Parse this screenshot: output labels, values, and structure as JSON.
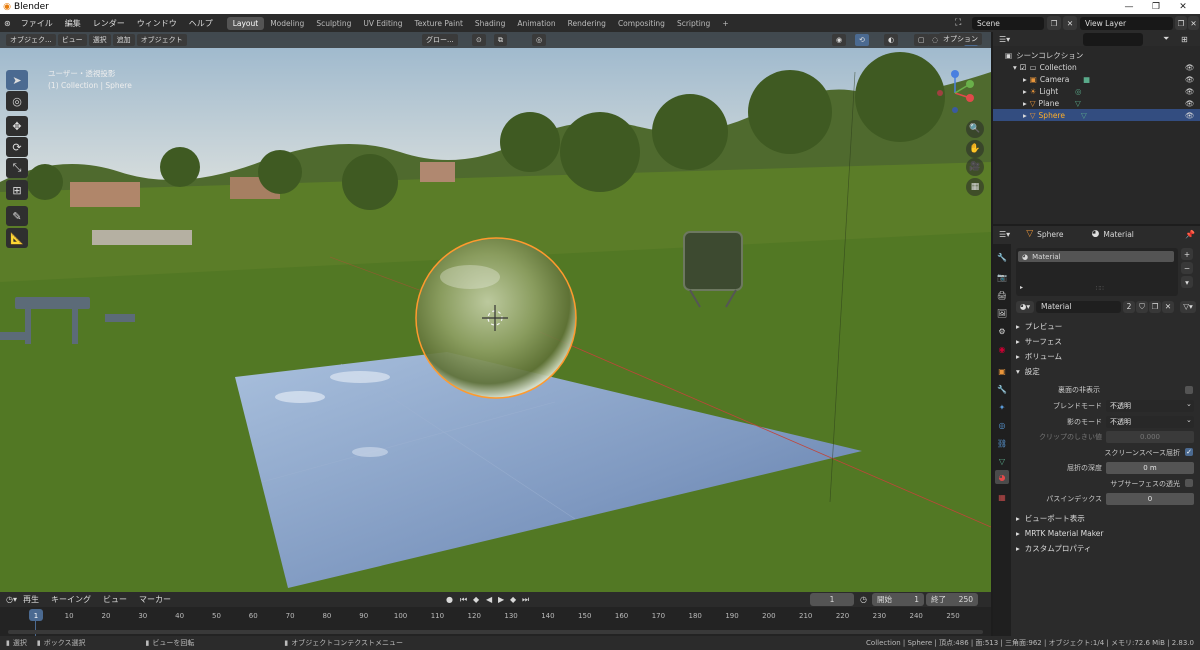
{
  "app": {
    "title": "Blender",
    "logo": "blender-logo-icon"
  },
  "menus": [
    "ファイル",
    "編集",
    "レンダー",
    "ウィンドウ",
    "ヘルプ"
  ],
  "workspaces": [
    "Layout",
    "Modeling",
    "Sculpting",
    "UV Editing",
    "Texture Paint",
    "Shading",
    "Animation",
    "Rendering",
    "Compositing",
    "Scripting",
    "+"
  ],
  "scene": {
    "label": "Scene"
  },
  "viewlayer": {
    "label": "View Layer"
  },
  "viewport_header": {
    "mode": "オブジェク...",
    "menus": [
      "ビュー",
      "選択",
      "追加",
      "オブジェクト"
    ],
    "transform": "グロー...",
    "options": "オプション"
  },
  "viewport_overlay": {
    "view_name": "ユーザー・透視投影",
    "object_info": "(1) Collection | Sphere"
  },
  "outliner": {
    "title": "シーンコレクション",
    "items": [
      {
        "name": "Collection"
      },
      {
        "name": "Camera"
      },
      {
        "name": "Light"
      },
      {
        "name": "Plane"
      },
      {
        "name": "Sphere"
      }
    ]
  },
  "props": {
    "object": "Sphere",
    "tab": "Material",
    "slot": "Material",
    "material_name": "Material",
    "users": "2",
    "sections": [
      "プレビュー",
      "サーフェス",
      "ボリューム",
      "設定"
    ],
    "settings": {
      "backface_label": "裏面の非表示",
      "blend_label": "ブレンドモード",
      "blend_value": "不透明",
      "shadow_label": "影のモード",
      "shadow_value": "不透明",
      "clip_label": "クリップのしきい値",
      "clip_value": "0.000",
      "ssr_label": "スクリーンスペース屈折",
      "depth_label": "屈折の深度",
      "depth_value": "0 m",
      "sss_label": "サブサーフェスの透光",
      "pass_label": "パスインデックス",
      "pass_value": "0"
    },
    "lower_sections": [
      "ビューポート表示",
      "MRTK Material Maker",
      "カスタムプロパティ"
    ]
  },
  "timeline": {
    "menus": [
      "再生",
      "キーイング",
      "ビュー",
      "マーカー"
    ],
    "current": "1",
    "start_label": "開始",
    "start": "1",
    "end_label": "終了",
    "end": "250",
    "ticks": [
      "1",
      "10",
      "20",
      "30",
      "40",
      "50",
      "60",
      "70",
      "80",
      "90",
      "100",
      "110",
      "120",
      "130",
      "140",
      "150",
      "160",
      "170",
      "180",
      "190",
      "200",
      "210",
      "220",
      "230",
      "240",
      "250"
    ]
  },
  "status": {
    "select": "選択",
    "box": "ボックス選択",
    "rotate": "ビューを回転",
    "context": "オブジェクトコンテクストメニュー",
    "stats": "Collection | Sphere | 頂点:486 | 面:513 | 三角面:962 | オブジェクト:1/4 | メモリ:72.6 MiB | 2.83.0"
  },
  "colors": {
    "accent": "#4b6a91",
    "selection": "#ff9a2e",
    "header": "#2b2b2b"
  }
}
